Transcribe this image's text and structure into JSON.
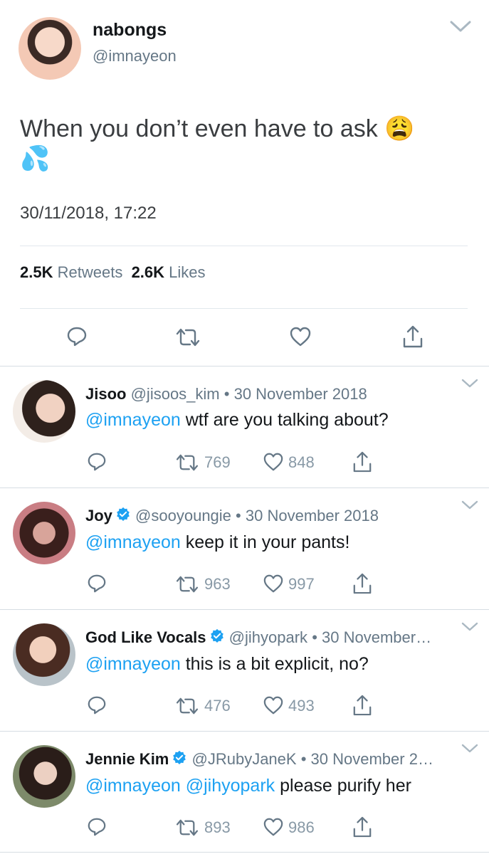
{
  "main_tweet": {
    "display_name": "nabongs",
    "handle": "@imnayeon",
    "text": "When you don’t even have to ask",
    "emoji_1": "😩",
    "emoji_2": "💦",
    "timestamp": "30/11/2018, 17:22",
    "retweets_count": "2.5K",
    "retweets_label": "Retweets",
    "likes_count": "2.6K",
    "likes_label": "Likes"
  },
  "replies": [
    {
      "name": "Jisoo",
      "handle": "@jisoos_kim",
      "date": "30 November 2018",
      "verified": false,
      "mentions": "@imnayeon",
      "text": "wtf are you talking about?",
      "retweets": "769",
      "likes": "848"
    },
    {
      "name": "Joy",
      "handle": "@sooyoungie",
      "date": "30 November 2018",
      "verified": true,
      "mentions": "@imnayeon",
      "text": "keep it in your pants!",
      "retweets": "963",
      "likes": "997"
    },
    {
      "name": "God Like Vocals",
      "handle": "@jihyopark",
      "date": "30 November…",
      "verified": true,
      "mentions": "@imnayeon",
      "text": "this is a bit explicit, no?",
      "retweets": "476",
      "likes": "493"
    },
    {
      "name": "Jennie Kim",
      "handle": "@JRubyJaneK",
      "date": "30 November 2…",
      "verified": true,
      "mentions": "@imnayeon @jihyopark",
      "text": "please purify her",
      "retweets": "893",
      "likes": "986"
    }
  ],
  "separator": "•",
  "colors": {
    "link": "#1da1f2",
    "muted": "#657786",
    "icon": "#657786",
    "verified": "#1da1f2"
  },
  "icons": [
    "chevron-down-icon",
    "reply-icon",
    "retweet-icon",
    "like-icon",
    "share-icon",
    "verified-badge-icon"
  ]
}
